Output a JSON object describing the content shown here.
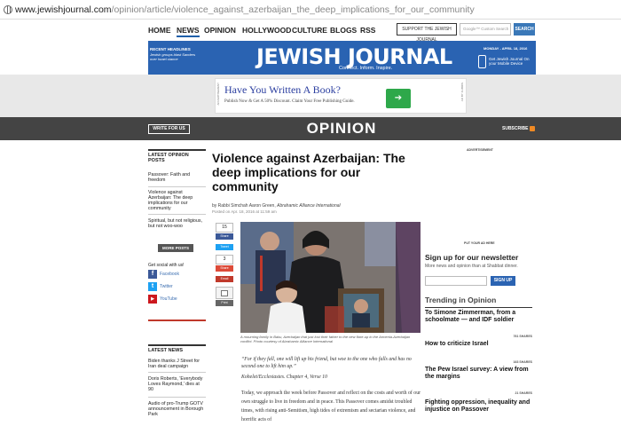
{
  "browser": {
    "url_domain": "www.jewishjournal.com",
    "url_path": "/opinion/article/violence_against_azerbaijan_the_deep_implications_for_our_community"
  },
  "nav": {
    "items": [
      "HOME",
      "NEWS",
      "OPINION",
      "HOLLYWOOD",
      "CULTURE",
      "BLOGS",
      "RSS"
    ],
    "active": "NEWS",
    "support_label": "SUPPORT THE JEWISH JOURNAL",
    "search_placeholder": "Google™ Custom Search",
    "search_label": "SEARCH"
  },
  "header": {
    "recent_label": "RECENT HEADLINES",
    "recent_item": "Jewish groups blast Sanders over Israel stance",
    "logo": "JEWISH JOURNAL",
    "tagline": "Connect. Inform. Inspire.",
    "date": "MONDAY - APRIL 18, 2016",
    "mobile_text": "Get Jewish Journal On your Mobile Device"
  },
  "ad": {
    "side_left": "ADVERTISEMENT",
    "side_right": "AD BY XLIBRIS",
    "title": "Have You Written A Book?",
    "text": "Publish Now & Get A 50% Discount. Claim Your Free Publishing Guide.",
    "button": "➔"
  },
  "section": {
    "write_label": "WRITE FOR US",
    "title": "OPINION",
    "subscribe_label": "SUBSCRIBE"
  },
  "sidebar": {
    "latest_opinion_heading": "LATEST OPINION POSTS",
    "opinion_posts": [
      "Passover: Faith and freedom",
      "Violence against Azerbaijan: The deep implications for our community",
      "Spiritual, but not religious, but not woo-woo"
    ],
    "more_posts_label": "MORE POSTS",
    "social_title": "Get social with us!",
    "social": [
      {
        "name": "Facebook",
        "color": "#3b5998",
        "glyph": "f"
      },
      {
        "name": "Twitter",
        "color": "#1da1f2",
        "glyph": "t"
      },
      {
        "name": "YouTube",
        "color": "#cc181e",
        "glyph": "▶"
      }
    ],
    "latest_news_heading": "LATEST NEWS",
    "news_posts": [
      "Biden thanks J Street for Iran deal campaign",
      "Doris Roberts, 'Everybody Loves Raymond,' dies at 90",
      "Audio of pro-Trump GOTV announcement in Borough Park"
    ]
  },
  "article": {
    "headline": "Violence against Azerbaijan: The deep implications for our community",
    "byline_prefix": "by Rabbi Simchah Aaron Green,",
    "byline_org": "Abrahamic Alliance International",
    "posted": "Posted on Apr. 18, 2016 at 11:59 am",
    "caption": "A mourning family in Baku, Azerbaijan that just lost their father to the new flare-up in the Armenia-Azerbaijan conflict. Photo courtesy of Abrahamic Alliance International",
    "quote": "“For if they fall, one will lift up his friend, but woe to the one who falls and has no second one to lift him up.”",
    "cite": "Kohelet/Ecclesiastes. Chapter 4, Verse 10",
    "body": "Today, we approach the week before Passover and reflect on the costs and worth of our own struggle to live in freedom and in peace. This Passover comes amidst troubled times, with rising anti-Semitism, high tides of extremism and sectarian violence, and horrific acts of"
  },
  "share": {
    "fb_count": "15",
    "fb_label": "Share",
    "tweet_label": "Tweet",
    "gplus_count": "3",
    "gplus_label": "Share",
    "email_label": "Email",
    "print_label": "Print"
  },
  "right": {
    "ad_label": "ADVERTISEMENT",
    "ad_here": "PUT YOUR AD HERE",
    "newsletter_title": "Sign up for our newsletter",
    "newsletter_sub": "More news and opinion than at Shabbat dinner.",
    "signup_label": "SIGN UP",
    "trending_title": "Trending in Opinion",
    "trending": [
      {
        "title": "To Simone Zimmerman, from a schoolmate — and IDF soldier",
        "shares": "761 SHARES"
      },
      {
        "title": "How to criticize Israel",
        "shares": "163 SHARES"
      },
      {
        "title": "The Pew Israel survey: A view from the margins",
        "shares": "21 SHARES"
      },
      {
        "title": "Fighting oppression, inequality and injustice on Passover",
        "shares": ""
      }
    ]
  }
}
